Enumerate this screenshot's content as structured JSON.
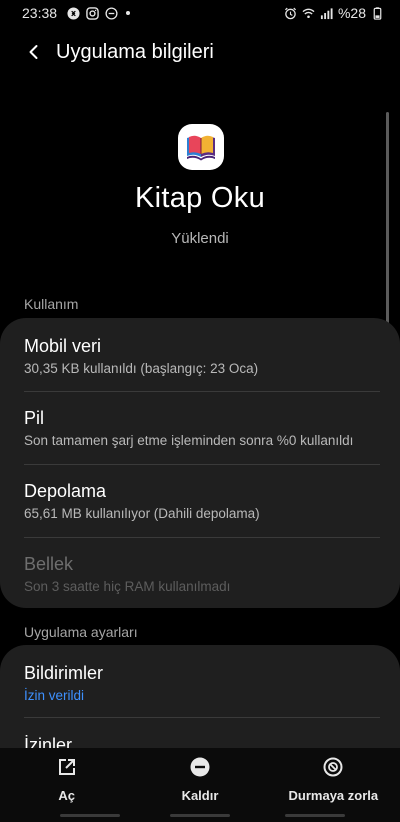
{
  "status_bar": {
    "time": "23:38",
    "battery": "%28",
    "left_icons": [
      "shazam-icon",
      "instagram-icon",
      "do-not-disturb-icon"
    ],
    "right_icons": [
      "alarm-icon",
      "wifi-icon",
      "signal-icon",
      "battery-icon"
    ]
  },
  "header": {
    "title": "Uygulama bilgileri"
  },
  "app": {
    "name": "Kitap Oku",
    "status": "Yüklendi",
    "icon": "open-book-icon"
  },
  "usage": {
    "section_label": "Kullanım",
    "items": [
      {
        "title": "Mobil veri",
        "subtitle": "30,35 KB kullanıldı (başlangıç: 23 Oca)"
      },
      {
        "title": "Pil",
        "subtitle": "Son tamamen şarj etme işleminden sonra %0 kullanıldı"
      },
      {
        "title": "Depolama",
        "subtitle": "65,61 MB kullanılıyor (Dahili depolama)"
      },
      {
        "title": "Bellek",
        "subtitle": "Son 3 saatte hiç RAM kullanılmadı",
        "disabled": true
      }
    ]
  },
  "app_settings": {
    "section_label": "Uygulama ayarları",
    "items": [
      {
        "title": "Bildirimler",
        "subtitle": "İzin verildi"
      },
      {
        "title": "İzinler"
      }
    ]
  },
  "bottom_actions": {
    "open": "Aç",
    "uninstall": "Kaldır",
    "force_stop": "Durmaya zorla"
  },
  "colors": {
    "background": "#000000",
    "card": "#1f1f1f",
    "accent": "#3e91ff"
  }
}
